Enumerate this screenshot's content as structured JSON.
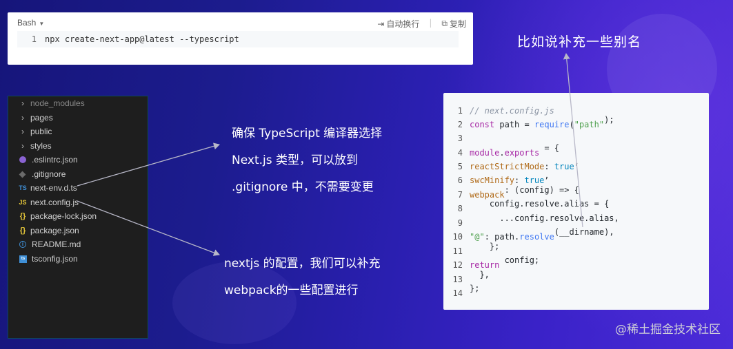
{
  "terminal": {
    "language": "Bash",
    "wrap_label": "自动换行",
    "copy_label": "复制",
    "line_number": "1",
    "command": "npx create-next-app@latest --typescript"
  },
  "heading": "比如说补充一些别名",
  "explorer": {
    "items": [
      {
        "icon": "chevron-right-icon",
        "label": "node_modules"
      },
      {
        "icon": "chevron-right-icon",
        "label": "pages"
      },
      {
        "icon": "chevron-right-icon",
        "label": "public"
      },
      {
        "icon": "chevron-right-icon",
        "label": "styles"
      },
      {
        "icon": "eslint-icon",
        "label": ".eslintrc.json"
      },
      {
        "icon": "git-icon",
        "label": ".gitignore"
      },
      {
        "icon": "typescript-icon",
        "label": "next-env.d.ts",
        "badge": "TS"
      },
      {
        "icon": "javascript-icon",
        "label": "next.config.js",
        "badge": "JS"
      },
      {
        "icon": "json-icon",
        "label": "package-lock.json",
        "badge": "{}"
      },
      {
        "icon": "json-icon",
        "label": "package.json",
        "badge": "{}"
      },
      {
        "icon": "info-icon",
        "label": "README.md",
        "badge": "i"
      },
      {
        "icon": "tsconfig-icon",
        "label": "tsconfig.json",
        "badge": "ts"
      }
    ]
  },
  "notes": {
    "typescript": [
      "确保 TypeScript 编译器选择",
      "Next.js 类型，可以放到",
      ".gitignore 中，不需要变更"
    ],
    "nextjs": [
      "nextjs 的配置，我们可以补充",
      "webpack的一些配置进行"
    ]
  },
  "code": {
    "line_numbers": [
      "1",
      "2",
      "3",
      "4",
      "5",
      "6",
      "7",
      "8",
      "9",
      "10",
      "11",
      "12",
      "13",
      "14"
    ],
    "lines": [
      "// next.config.js",
      "const path = require(\"path\");",
      "",
      "module.exports = {",
      "  reactStrictMode: true,",
      "  swcMinify: true,",
      "  webpack: (config) => {",
      "    config.resolve.alias = {",
      "      ...config.resolve.alias,",
      "      \"@\": path.resolve(__dirname),",
      "    };",
      "    return config;",
      "  },",
      "};"
    ]
  },
  "watermark": "@稀土掘金技术社区",
  "colors": {
    "background_start": "#16157a",
    "background_end": "#4b2bd8",
    "arrow": "#b8b8c8"
  }
}
